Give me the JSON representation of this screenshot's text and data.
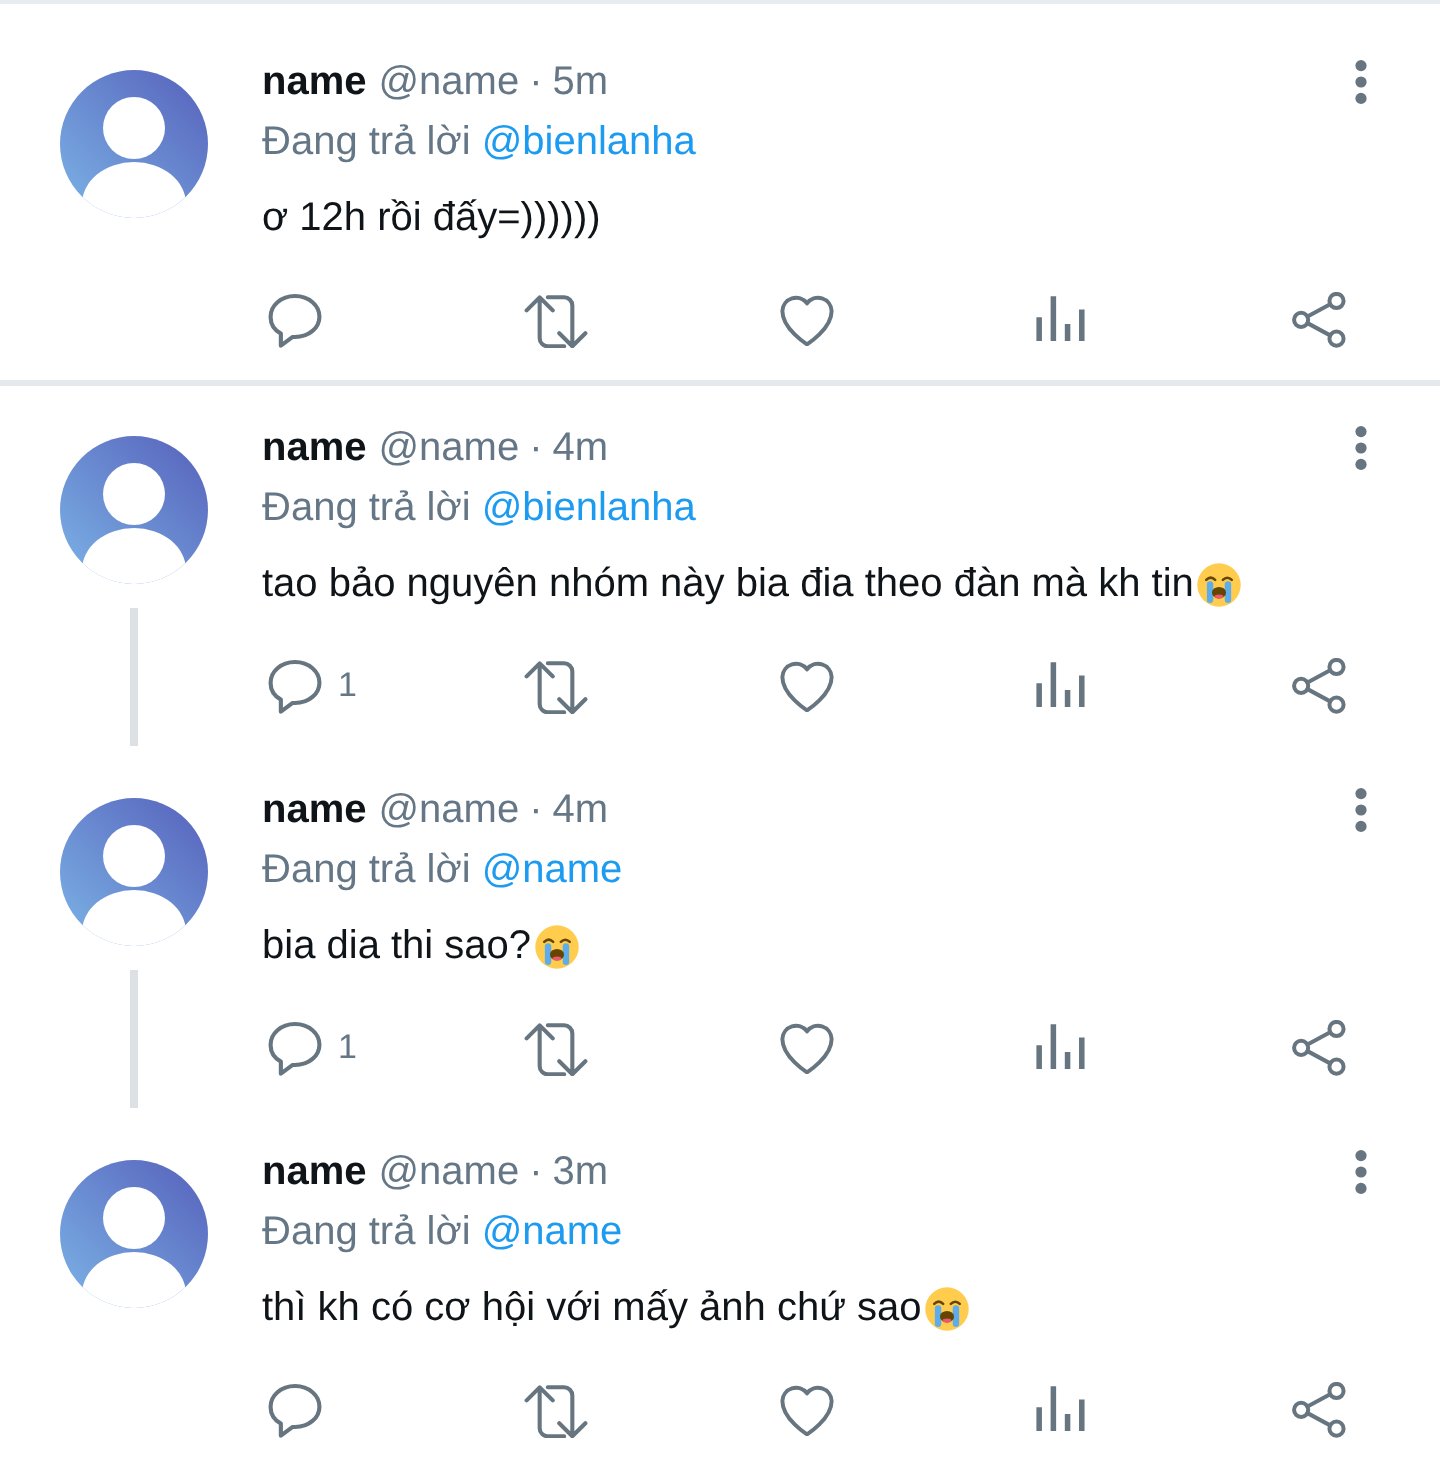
{
  "conversations": [
    {
      "tweets": [
        {
          "name": "name",
          "handle": "@name",
          "separator": "·",
          "time": "5m",
          "replying_to": {
            "label": "Đang trả lời",
            "mention": "@bienlanha"
          },
          "text": "ơ 12h rồi đấy=))))))",
          "actions": [
            {
              "kind": "reply"
            },
            {
              "kind": "retweet"
            },
            {
              "kind": "like"
            },
            {
              "kind": "views"
            },
            {
              "kind": "share"
            }
          ]
        }
      ]
    },
    {
      "tweets": [
        {
          "name": "name",
          "handle": "@name",
          "separator": "·",
          "time": "4m",
          "replying_to": {
            "label": "Đang trả lời",
            "mention": "@bienlanha"
          },
          "text": "tao bảo nguyên nhóm này bia đia theo đàn mà kh tin",
          "trailing_emoji": {
            "kind": "crying"
          },
          "actions": [
            {
              "kind": "reply",
              "count": "1"
            },
            {
              "kind": "retweet"
            },
            {
              "kind": "like"
            },
            {
              "kind": "views"
            },
            {
              "kind": "share"
            }
          ]
        },
        {
          "name": "name",
          "handle": "@name",
          "separator": "·",
          "time": "4m",
          "replying_to": {
            "label": "Đang trả lời",
            "mention": "@name"
          },
          "text": "bia dia thi sao?",
          "trailing_emoji": {
            "kind": "crying"
          },
          "actions": [
            {
              "kind": "reply",
              "count": "1"
            },
            {
              "kind": "retweet"
            },
            {
              "kind": "like"
            },
            {
              "kind": "views"
            },
            {
              "kind": "share"
            }
          ]
        },
        {
          "name": "name",
          "handle": "@name",
          "separator": "·",
          "time": "3m",
          "replying_to": {
            "label": "Đang trả lời",
            "mention": "@name"
          },
          "text": "thì kh có cơ hội với mấy ảnh chứ sao",
          "trailing_emoji": {
            "kind": "crying"
          },
          "actions": [
            {
              "kind": "reply"
            },
            {
              "kind": "retweet"
            },
            {
              "kind": "like"
            },
            {
              "kind": "views"
            },
            {
              "kind": "share"
            }
          ]
        }
      ]
    }
  ]
}
